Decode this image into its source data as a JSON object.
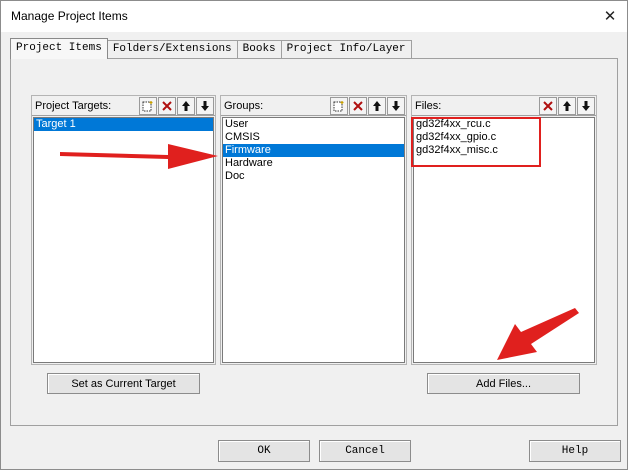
{
  "window": {
    "title": "Manage Project Items"
  },
  "tabs": [
    {
      "label": "Project Items",
      "active": true
    },
    {
      "label": "Folders/Extensions",
      "active": false
    },
    {
      "label": "Books",
      "active": false
    },
    {
      "label": "Project Info/Layer",
      "active": false
    }
  ],
  "targets": {
    "label": "Project Targets:",
    "items": [
      "Target 1"
    ],
    "selected": 0
  },
  "groups": {
    "label": "Groups:",
    "items": [
      "User",
      "CMSIS",
      "Firmware",
      "Hardware",
      "Doc"
    ],
    "selected": 2
  },
  "files": {
    "label": "Files:",
    "items": [
      "gd32f4xx_rcu.c",
      "gd32f4xx_gpio.c",
      "gd32f4xx_misc.c"
    ]
  },
  "buttons": {
    "set_current": "Set as Current Target",
    "add_files": "Add Files...",
    "ok": "OK",
    "cancel": "Cancel",
    "help": "Help"
  },
  "icons": {
    "new": "new-item-icon",
    "delete": "delete-icon",
    "up": "move-up-icon",
    "down": "move-down-icon",
    "close": "close-icon"
  },
  "colors": {
    "selection": "#0078d7",
    "annotation": "#e0201e"
  }
}
